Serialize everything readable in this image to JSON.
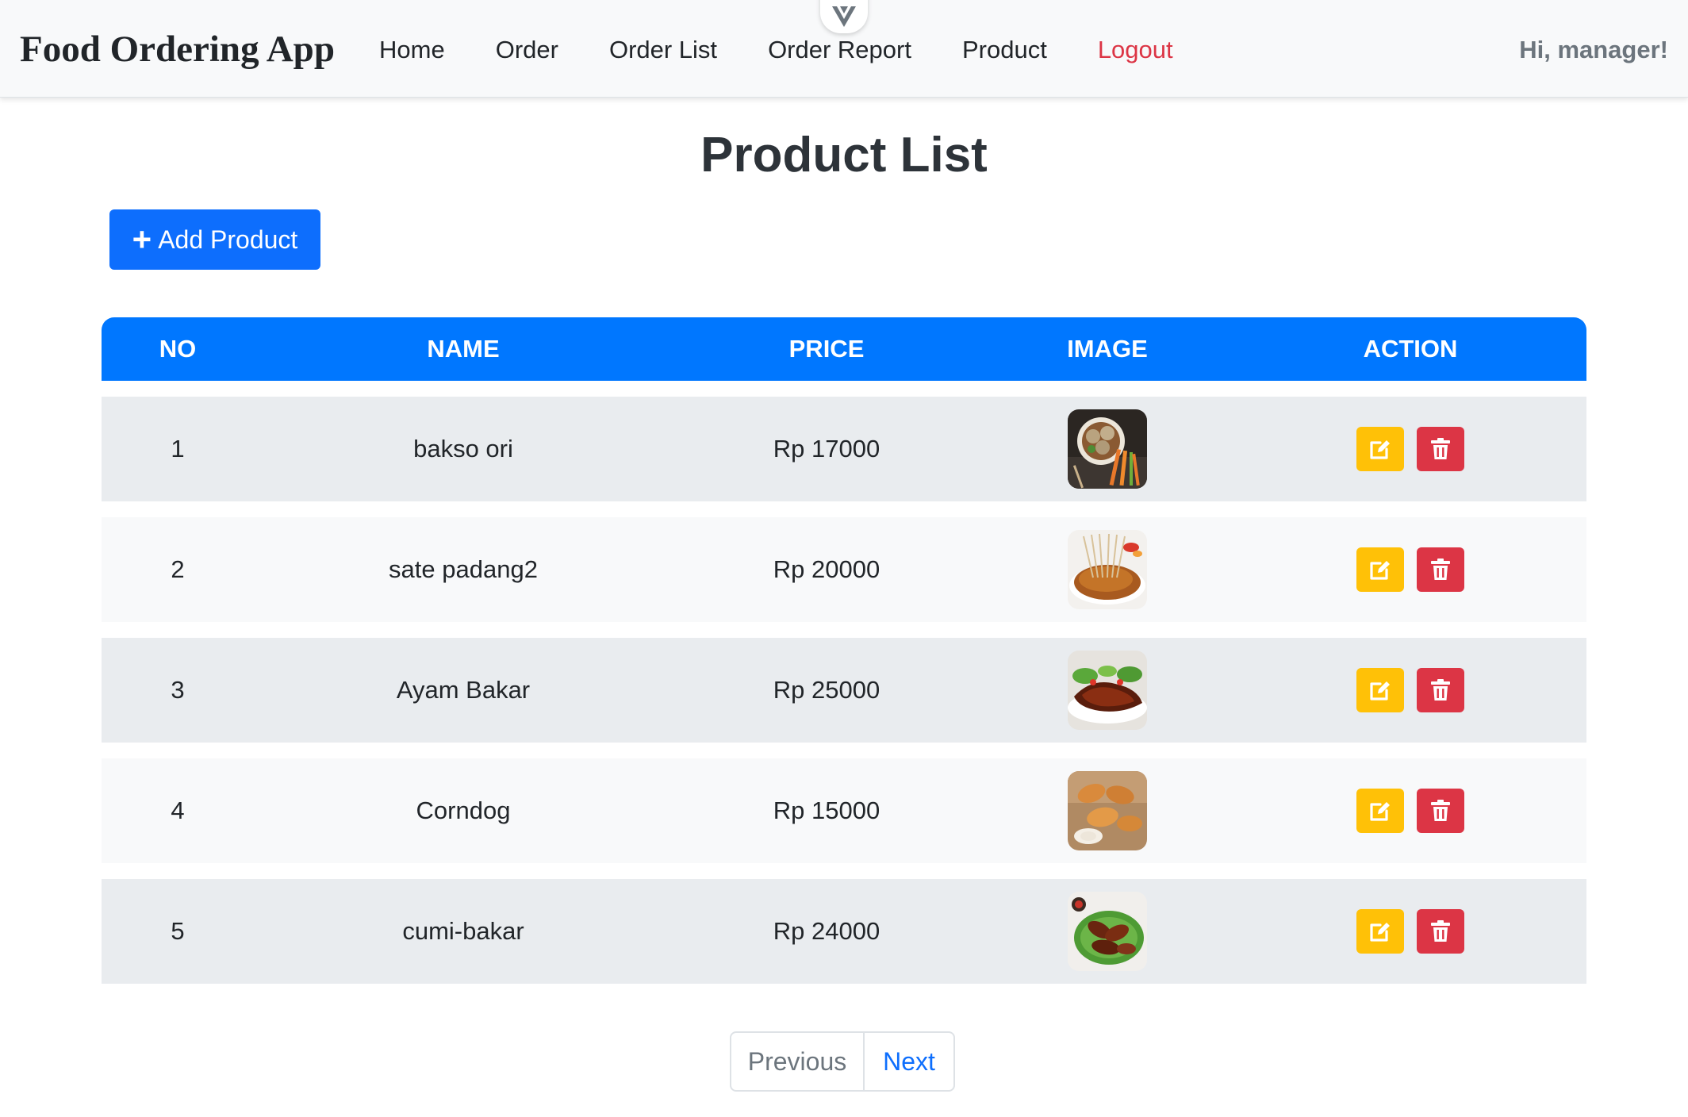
{
  "navbar": {
    "brand": "Food Ordering App",
    "links": [
      "Home",
      "Order",
      "Order List",
      "Order Report",
      "Product",
      "Logout"
    ],
    "greeting": "Hi, manager!"
  },
  "page": {
    "title": "Product List",
    "add_label": "Add Product"
  },
  "table": {
    "headers": [
      "NO",
      "NAME",
      "PRICE",
      "IMAGE",
      "ACTION"
    ],
    "rows": [
      {
        "no": "1",
        "name": "bakso ori",
        "price": "Rp 17000"
      },
      {
        "no": "2",
        "name": "sate padang2",
        "price": "Rp 20000"
      },
      {
        "no": "3",
        "name": "Ayam Bakar",
        "price": "Rp 25000"
      },
      {
        "no": "4",
        "name": "Corndog",
        "price": "Rp 15000"
      },
      {
        "no": "5",
        "name": "cumi-bakar",
        "price": "Rp 24000"
      }
    ]
  },
  "pagination": {
    "previous": "Previous",
    "next": "Next"
  },
  "colors": {
    "primary": "#0d6efd",
    "table_header": "#0077ff",
    "edit": "#ffc107",
    "delete": "#dc3545",
    "logout": "#dc3545"
  },
  "icons": {
    "add": "plus-icon",
    "edit": "pencil-square-icon",
    "delete": "trash-icon",
    "devtools": "vue-logo-icon"
  }
}
